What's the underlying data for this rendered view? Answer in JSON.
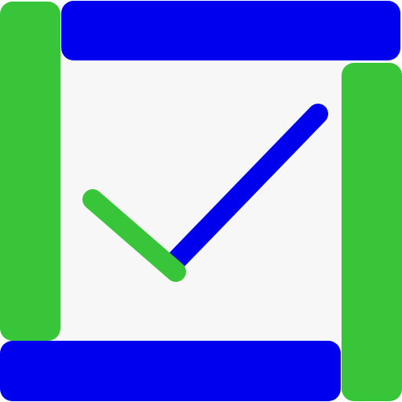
{
  "logo": {
    "icon": "checkmark-in-square-frame",
    "colors": {
      "background": "#ffffff",
      "inner_panel": "#f7f7f8",
      "green": "#38c53a",
      "blue": "#0000ee"
    }
  }
}
